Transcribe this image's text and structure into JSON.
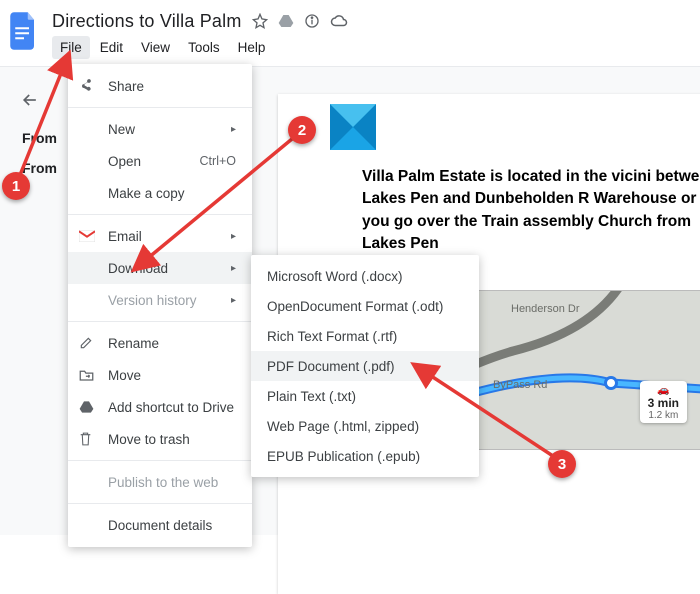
{
  "doc": {
    "title": "Directions to Villa Palm"
  },
  "menubar": {
    "file": "File",
    "edit": "Edit",
    "view": "View",
    "tools": "Tools",
    "help": "Help"
  },
  "side": {
    "word1": "From",
    "word2": "From"
  },
  "fileMenu": {
    "share": "Share",
    "new": "New",
    "open": "Open",
    "open_sc": "Ctrl+O",
    "copy": "Make a copy",
    "email": "Email",
    "download": "Download",
    "version": "Version history",
    "rename": "Rename",
    "move": "Move",
    "shortcut": "Add shortcut to Drive",
    "trash": "Move to trash",
    "publish": "Publish to the web",
    "details": "Document details"
  },
  "downloadMenu": {
    "docx": "Microsoft Word (.docx)",
    "odt": "OpenDocument Format (.odt)",
    "rtf": "Rich Text Format (.rtf)",
    "pdf": "PDF Document (.pdf)",
    "txt": "Plain Text (.txt)",
    "html": "Web Page (.html, zipped)",
    "epub": "EPUB Publication (.epub)"
  },
  "content": {
    "paragraph": "Villa Palm Estate is located in the vicini between Lakes Pen and Dunbeholden R Warehouse or as you go over the Train assembly Church from Lakes Pen"
  },
  "map": {
    "road1": "Henderson Dr",
    "road2": "ByPass Rd",
    "badge_time": "3 min",
    "badge_dist": "1.2 km"
  },
  "callouts": {
    "c1": "1",
    "c2": "2",
    "c3": "3"
  }
}
